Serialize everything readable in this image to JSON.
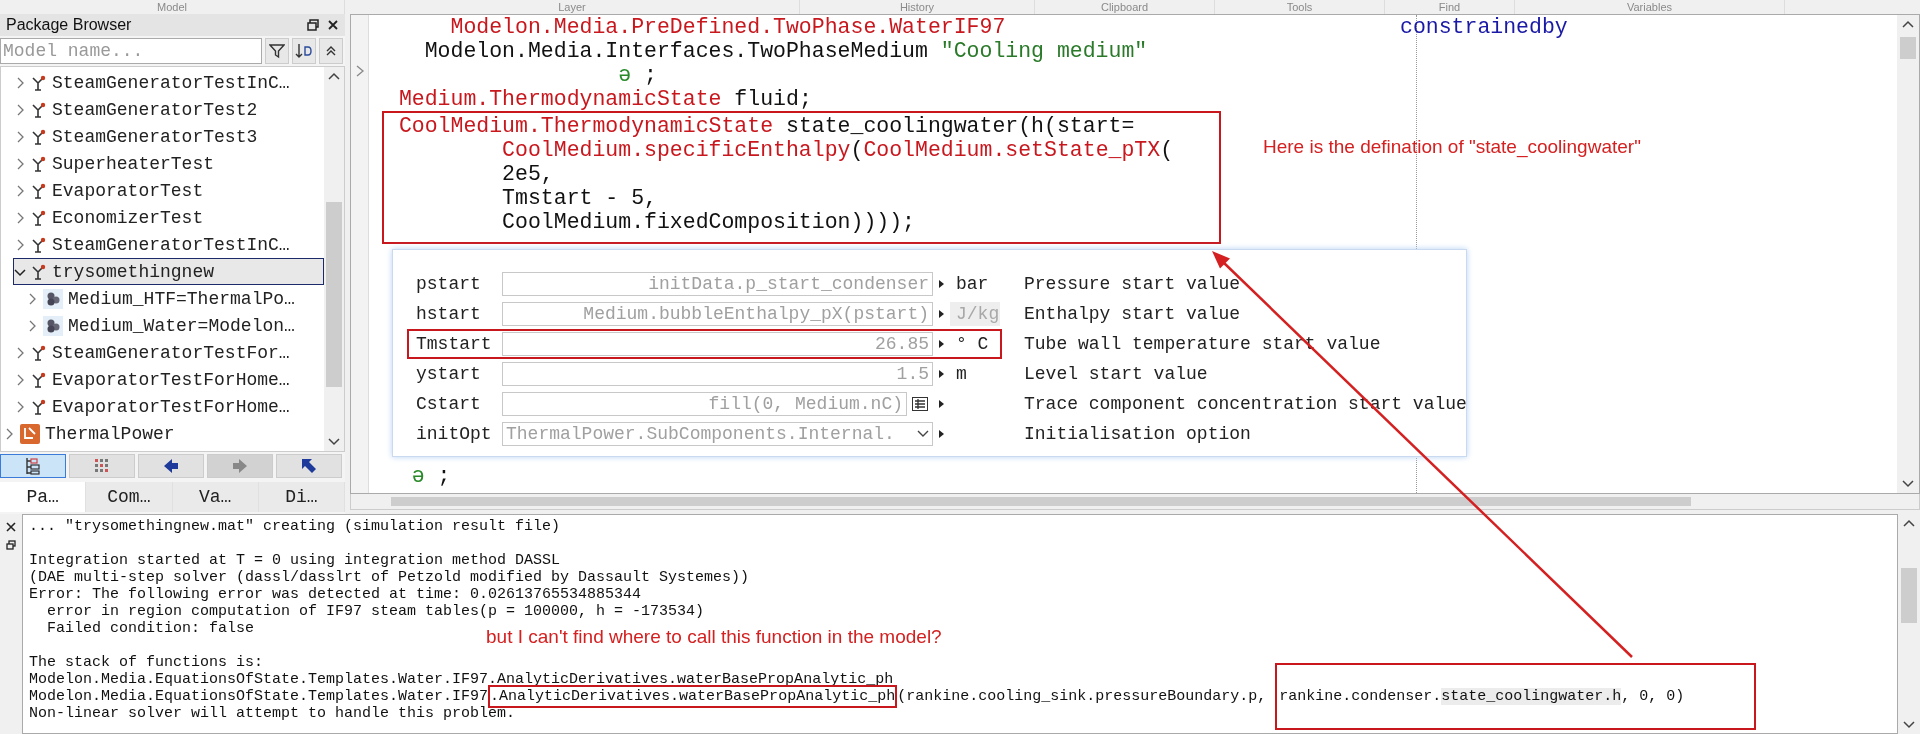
{
  "toolbar_groups": [
    "Model",
    "Layer",
    "History",
    "Clipboard",
    "Tools",
    "Find",
    "Variables"
  ],
  "package_browser": {
    "title": "Package Browser",
    "search": {
      "placeholder": "Model name..."
    },
    "tree": [
      {
        "label": "SteamGeneratorTestInC…",
        "kind": "model",
        "expanded": false,
        "selected": false
      },
      {
        "label": "SteamGeneratorTest2",
        "kind": "model",
        "expanded": false,
        "selected": false
      },
      {
        "label": "SteamGeneratorTest3",
        "kind": "model",
        "expanded": false,
        "selected": false
      },
      {
        "label": "SuperheaterTest",
        "kind": "model",
        "expanded": false,
        "selected": false
      },
      {
        "label": "EvaporatorTest",
        "kind": "model",
        "expanded": false,
        "selected": false
      },
      {
        "label": "EconomizerTest",
        "kind": "model",
        "expanded": false,
        "selected": false
      },
      {
        "label": "SteamGeneratorTestInC…",
        "kind": "model",
        "expanded": false,
        "selected": false
      },
      {
        "label": "trysomethingnew",
        "kind": "model",
        "expanded": true,
        "selected": true,
        "children": [
          {
            "label": "Medium_HTF=ThermalPo…",
            "kind": "medium",
            "expanded": false,
            "selected": false
          },
          {
            "label": "Medium_Water=Modelon…",
            "kind": "medium",
            "expanded": false,
            "selected": false
          }
        ]
      },
      {
        "label": "SteamGeneratorTestFor…",
        "kind": "model",
        "expanded": false,
        "selected": false
      },
      {
        "label": "EvaporatorTestForHome…",
        "kind": "model",
        "expanded": false,
        "selected": false
      },
      {
        "label": "EvaporatorTestForHome…",
        "kind": "model",
        "expanded": false,
        "selected": false
      },
      {
        "label": "ThermalPower",
        "kind": "package",
        "expanded": false,
        "selected": false
      }
    ],
    "toolbar": [
      {
        "kind": "tree",
        "selected": true,
        "disabled": false
      },
      {
        "kind": "grid",
        "selected": false,
        "disabled": false
      },
      {
        "kind": "back",
        "selected": false,
        "disabled": false
      },
      {
        "kind": "forward",
        "selected": false,
        "disabled": true
      },
      {
        "kind": "up",
        "selected": false,
        "disabled": false
      }
    ],
    "tabs": [
      {
        "label": "Pa…",
        "selected": true
      },
      {
        "label": "Com…",
        "selected": false
      },
      {
        "label": "Va…",
        "selected": false
      },
      {
        "label": "Di…",
        "selected": false
      }
    ]
  },
  "code": {
    "margin_note": {
      "text": "constrainedby",
      "kind": "keyword"
    },
    "lines_before": [
      {
        "segments": [
          {
            "text": "     Modelon.Media.PreDefined.TwoPhase.WaterIF97",
            "kind": "type"
          }
        ]
      },
      {
        "segments": [
          {
            "text": "   Modelon.Media.Interfaces.TwoPhaseMedium ",
            "kind": "plain"
          },
          {
            "text": "\"Cooling medium\"",
            "kind": "string"
          }
        ]
      },
      {
        "segments": [
          {
            "text": "                  ə",
            "kind": "annotation"
          },
          {
            "text": " ;",
            "kind": "plain"
          }
        ]
      },
      {
        "segments": [
          {
            "text": " Medium.ThermodynamicState",
            "kind": "type"
          },
          {
            "text": " fluid;",
            "kind": "plain"
          }
        ]
      }
    ],
    "boxed_lines": [
      {
        "segments": [
          {
            "text": " CoolMedium.ThermodynamicState",
            "kind": "type"
          },
          {
            "text": " state_coolingwater(h(start=",
            "kind": "plain"
          }
        ]
      },
      {
        "segments": [
          {
            "text": "         CoolMedium.specificEnthalpy",
            "kind": "type"
          },
          {
            "text": "(",
            "kind": "plain"
          },
          {
            "text": "CoolMedium.setState_pTX",
            "kind": "type"
          },
          {
            "text": "(",
            "kind": "plain"
          }
        ]
      },
      {
        "segments": [
          {
            "text": "         2e5,",
            "kind": "plain"
          }
        ]
      },
      {
        "segments": [
          {
            "text": "         Tmstart - 5,",
            "kind": "plain"
          }
        ]
      },
      {
        "segments": [
          {
            "text": "         CoolMedium.fixedComposition))));",
            "kind": "plain"
          }
        ]
      }
    ],
    "lines_after": [
      {
        "segments": [
          {
            "text": "  ə",
            "kind": "annotation"
          },
          {
            "text": " ;",
            "kind": "plain"
          }
        ]
      }
    ],
    "note": "Here is the defination of \"state_coolingwater\""
  },
  "popup": {
    "rows": [
      {
        "name": "pstart",
        "value": "initData.p_start_condenser",
        "kind": "text",
        "unit": "bar",
        "unit_disabled": false,
        "description": "Pressure start value",
        "highlighted": false
      },
      {
        "name": "hstart",
        "value": "Medium.bubbleEnthalpy_pX(pstart)",
        "kind": "text",
        "unit": "J/kg",
        "unit_disabled": true,
        "description": "Enthalpy start value",
        "highlighted": false
      },
      {
        "name": "Tmstart",
        "value": "26.85",
        "kind": "text",
        "unit": "° C",
        "unit_disabled": false,
        "description": "Tube wall temperature start value",
        "highlighted": true
      },
      {
        "name": "ystart",
        "value": "1.5",
        "kind": "text",
        "unit": "m",
        "unit_disabled": false,
        "description": "Level start value",
        "highlighted": false
      },
      {
        "name": "Cstart",
        "value": "fill(0, Medium.nC)",
        "kind": "matrix",
        "description": "Trace component concentration start value",
        "highlighted": false
      },
      {
        "name": "initOpt",
        "value": "ThermalPower.SubComponents.Internal.",
        "kind": "dropdown",
        "description": "Initialisation option",
        "highlighted": false
      }
    ]
  },
  "log": {
    "note": "but I can't find where to call this function in the model?",
    "blocks": [
      [
        {
          "segments": [
            {
              "text": "... \"trysomethingnew.mat\" creating (simulation result file)",
              "kind": "plain",
              "marked": false
            }
          ]
        }
      ],
      [
        {
          "segments": [
            {
              "text": "Integration started at T = 0 using integration method DASSL",
              "kind": "plain",
              "marked": false
            }
          ]
        },
        {
          "segments": [
            {
              "text": "(DAE multi-step solver (dassl/dasslrt of Petzold modified by Dassault Systemes))",
              "kind": "plain",
              "marked": false
            }
          ]
        },
        {
          "segments": [
            {
              "text": "Error: The following error was detected at time: 0.02613765534885344",
              "kind": "plain",
              "marked": false
            }
          ]
        },
        {
          "segments": [
            {
              "text": "  error in region computation of IF97 steam tables(p = 100000, h = -173534)",
              "kind": "plain",
              "marked": false
            }
          ]
        },
        {
          "segments": [
            {
              "text": "  Failed condition: false",
              "kind": "plain",
              "marked": false
            }
          ]
        }
      ],
      [
        {
          "segments": [
            {
              "text": "The stack of functions is:",
              "kind": "plain",
              "marked": false
            }
          ]
        },
        {
          "segments": [
            {
              "text": "Modelon.Media.EquationsOfState.Templates.Water.IF97.AnalyticDerivatives.waterBasePropAnalytic_ph",
              "kind": "plain",
              "marked": false
            }
          ]
        },
        {
          "segments": [
            {
              "text": "Modelon.Media.EquationsOfState.Templates.Water.IF97",
              "kind": "plain",
              "marked": false
            },
            {
              "text": ".AnalyticDerivatives.waterBasePropAnalytic_ph",
              "kind": "boxed",
              "marked": false
            },
            {
              "text": "(rankine.cooling_sink.pressureBoundary.p, ",
              "kind": "plain",
              "marked": false
            },
            {
              "text": "rankine.condenser.",
              "kind": "boxed_area",
              "marked": false
            },
            {
              "text": "state_coolingwater.h",
              "kind": "boxed_area",
              "marked": true
            },
            {
              "text": ", 0, 0)",
              "kind": "boxed_area",
              "marked": false
            }
          ]
        },
        {
          "segments": [
            {
              "text": "Non-linear solver will attempt to handle this problem.",
              "kind": "plain",
              "marked": false
            }
          ]
        }
      ]
    ]
  }
}
